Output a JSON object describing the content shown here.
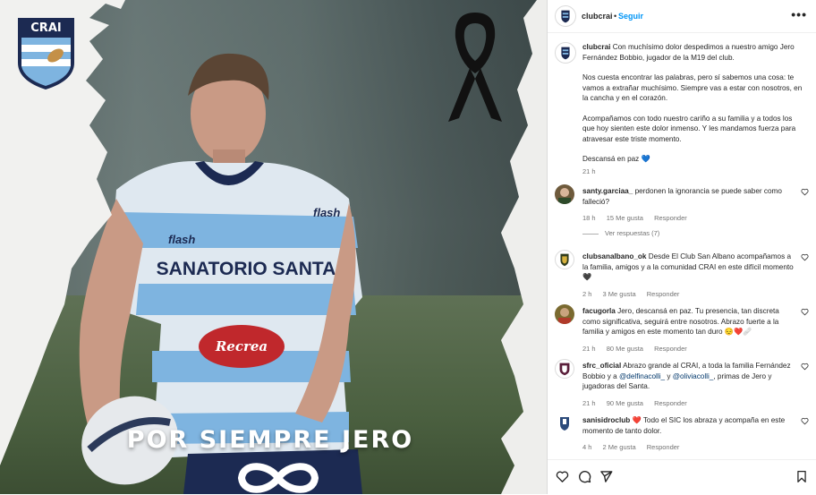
{
  "media": {
    "club_crest_text": "CRAI",
    "tribute_text": "POR SIEMPRE JERO",
    "jersey_text": "SANATORIO SANTA",
    "sponsor_text": "Recrea",
    "brand_text": "flash",
    "colors": {
      "sky_blue": "#7eb4e0",
      "navy": "#1c2a52",
      "ribbon": "#111111"
    }
  },
  "header": {
    "username": "clubcrai",
    "separator": "•",
    "follow_label": "Seguir",
    "more_label": "•••"
  },
  "caption": {
    "username": "clubcrai",
    "p1": "Con muchísimo dolor despedimos a nuestro amigo Jero Fernández Bobbio, jugador de la M19 del club.",
    "p2": "Nos cuesta encontrar las palabras, pero sí sabemos una cosa: te vamos a extrañar muchísimo. Siempre vas a estar con nosotros, en la cancha y en el corazón.",
    "p3": "Acompañamos con todo nuestro cariño a su familia y a todos los que hoy sienten este dolor inmenso. Y les mandamos fuerza para atravesar este triste momento.",
    "p4": "Descansá en paz 💙",
    "time": "21 h"
  },
  "comments": [
    {
      "username": "santy.garciaa_",
      "text": "perdonen la ignorancia se puede saber como falleció?",
      "time": "18 h",
      "likes": "15 Me gusta",
      "reply": "Responder",
      "view_replies": "Ver respuestas (7)"
    },
    {
      "username": "clubsanalbano_ok",
      "text": "Desde El Club San Albano acompañamos a la familia, amigos y a la comunidad CRAI en este difícil momento 🖤",
      "time": "2 h",
      "likes": "3 Me gusta",
      "reply": "Responder"
    },
    {
      "username": "facugorla",
      "text": "Jero, descansá en paz. Tu presencia, tan discreta como significativa, seguirá entre nosotros. Abrazo fuerte a la familia y amigos en este momento tan duro 😔❤️🩹",
      "time": "21 h",
      "likes": "80 Me gusta",
      "reply": "Responder"
    },
    {
      "username": "sfrc_oficial",
      "text_a": "Abrazo grande al CRAI, a toda la familia Fernández Bobbio y a ",
      "mention1": "@delfinacolli_",
      "text_b": " y ",
      "mention2": "@oliviacolli_",
      "text_c": ", primas de Jero y jugadoras del Santa.",
      "time": "21 h",
      "likes": "90 Me gusta",
      "reply": "Responder"
    },
    {
      "username": "sanisidroclub",
      "text": "❤️ Todo el SIC los abraza y acompaña en este momento de tanto dolor.",
      "time": "4 h",
      "likes": "2 Me gusta",
      "reply": "Responder"
    }
  ]
}
